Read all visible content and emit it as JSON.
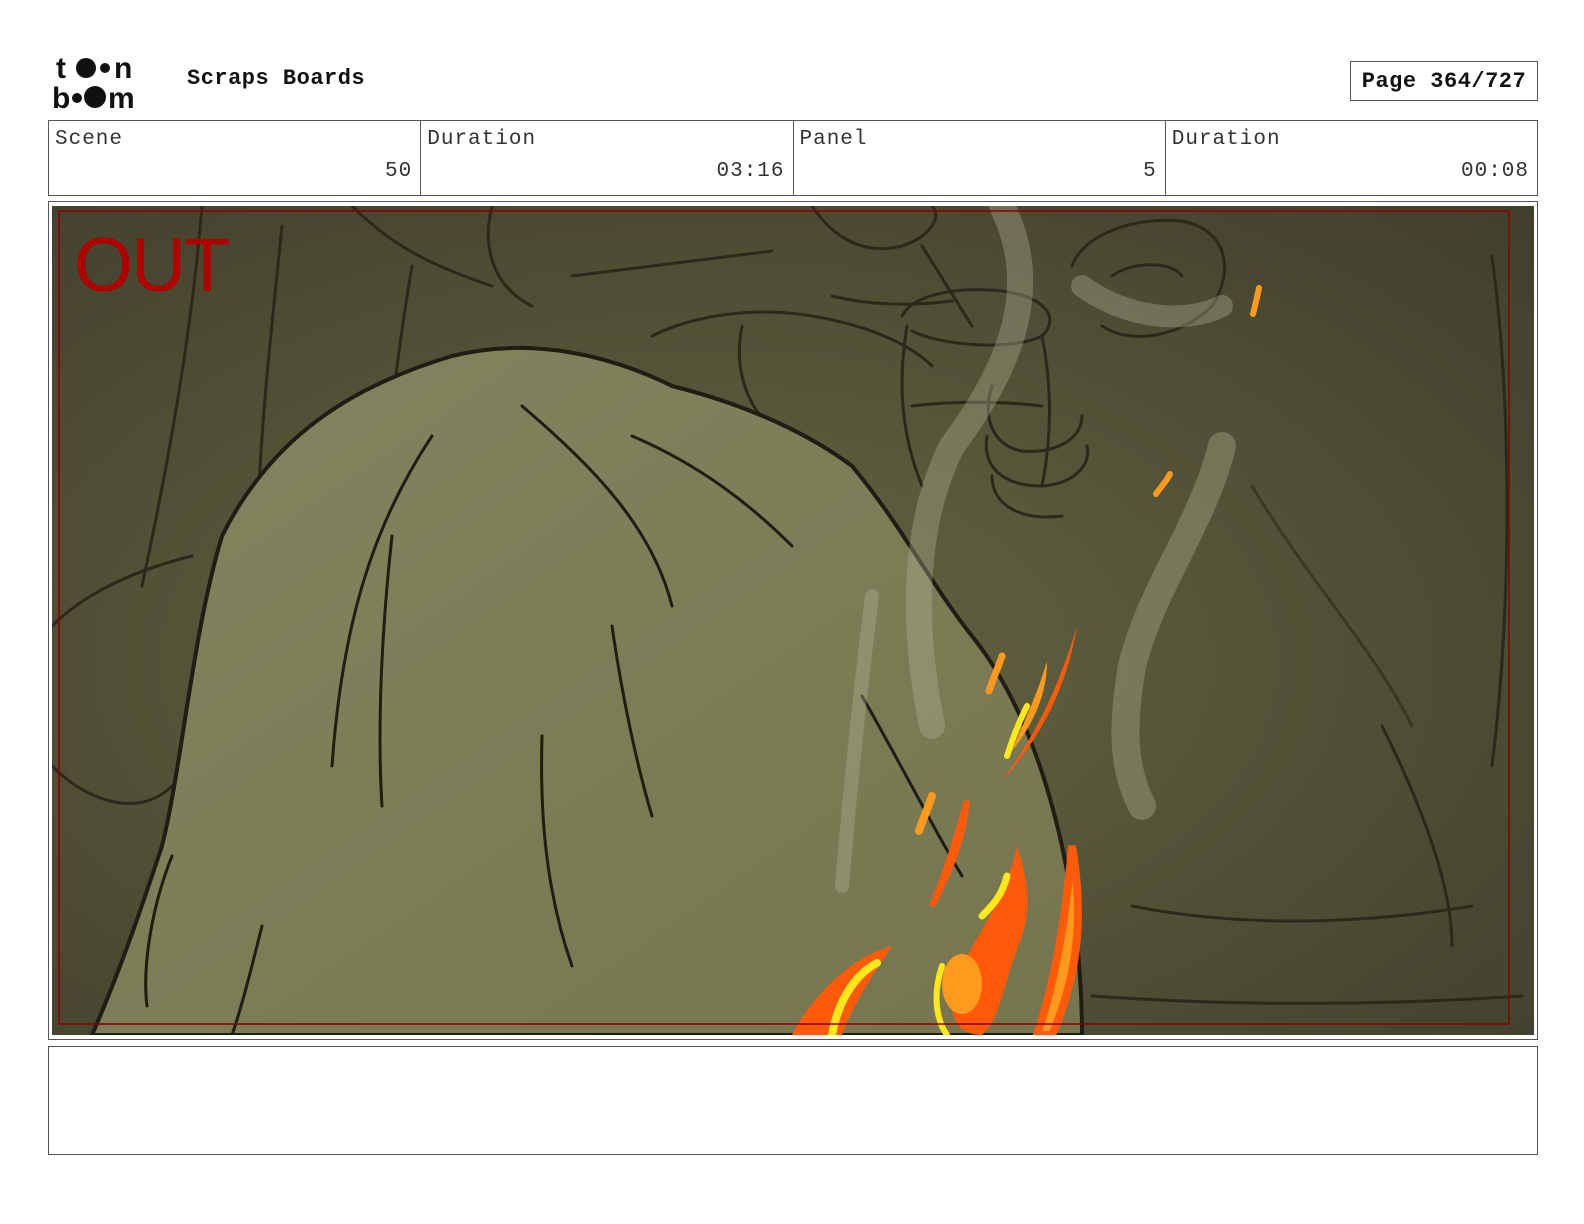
{
  "header": {
    "logo_text": "toon boom",
    "title": "Scraps Boards",
    "page_label": "Page 364/727"
  },
  "info": {
    "scene_label": "Scene",
    "scene_value": "50",
    "scene_duration_label": "Duration",
    "scene_duration_value": "03:16",
    "panel_label": "Panel",
    "panel_value": "5",
    "panel_duration_label": "Duration",
    "panel_duration_value": "00:08"
  },
  "panel": {
    "overlay_text": "OUT",
    "overlay_color": "#b00000",
    "background_color": "#5a5a3a",
    "cloak_color": "#7d7d58",
    "fire_colors": [
      "#ff5a0a",
      "#ff9a1f",
      "#ffe81a"
    ]
  },
  "notes": {
    "text": ""
  }
}
